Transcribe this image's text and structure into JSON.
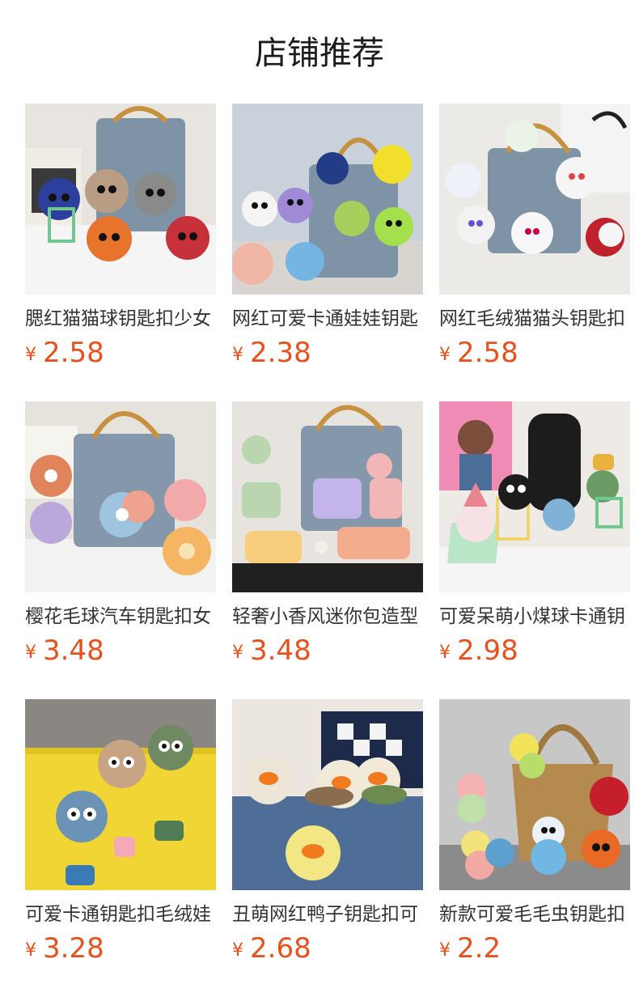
{
  "page": {
    "title": "店铺推荐"
  },
  "products": [
    {
      "name": "腮红猫猫球钥匙扣少女",
      "currency": "¥",
      "price": "2.58",
      "image": "keychain-cat-pompoms-photo"
    },
    {
      "name": "网红可爱卡通娃娃钥匙",
      "currency": "¥",
      "price": "2.38",
      "image": "keychain-cartoon-dolls-photo"
    },
    {
      "name": "网红毛绒猫猫头钥匙扣",
      "currency": "¥",
      "price": "2.58",
      "image": "keychain-white-cat-heads-photo"
    },
    {
      "name": "樱花毛球汽车钥匙扣女",
      "currency": "¥",
      "price": "3.48",
      "image": "keychain-sakura-flower-photo"
    },
    {
      "name": "轻奢小香风迷你包造型",
      "currency": "¥",
      "price": "3.48",
      "image": "keychain-mini-bags-photo"
    },
    {
      "name": "可爱呆萌小煤球卡通钥",
      "currency": "¥",
      "price": "2.98",
      "image": "keychain-soot-ball-photo"
    },
    {
      "name": "可爱卡通钥匙扣毛绒娃",
      "currency": "¥",
      "price": "3.28",
      "image": "keychain-long-leg-pompoms-photo"
    },
    {
      "name": "丑萌网红鸭子钥匙扣可",
      "currency": "¥",
      "price": "2.68",
      "image": "keychain-duck-photo"
    },
    {
      "name": "新款可爱毛毛虫钥匙扣",
      "currency": "¥",
      "price": "2.2",
      "image": "keychain-caterpillar-photo"
    }
  ]
}
